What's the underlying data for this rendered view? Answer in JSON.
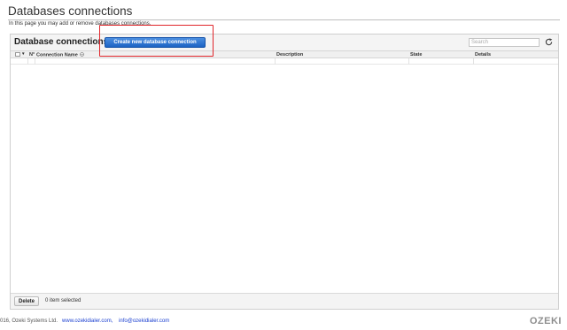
{
  "page": {
    "title": "Databases connections",
    "subtitle": "In this page you may add or remove databases connections."
  },
  "panel": {
    "heading": "Database connections",
    "create_button_label": "Create new database connection",
    "search_placeholder": "Search"
  },
  "table": {
    "columns": {
      "number": "N°",
      "connection_name": "Connection Name",
      "description": "Description",
      "state": "State",
      "details": "Details"
    },
    "rows": []
  },
  "footer": {
    "delete_label": "Delete",
    "selected_count": "0 item selected"
  },
  "page_footer": {
    "copyright": "016, Ozeki Systems Ltd.",
    "website": "www.ozekidialer.com,",
    "email": "info@ozekidialer.com"
  },
  "brand": {
    "logo_text": "OZEKI",
    "accent_color": "#1d64c4",
    "highlight_color": "#e0262b"
  }
}
